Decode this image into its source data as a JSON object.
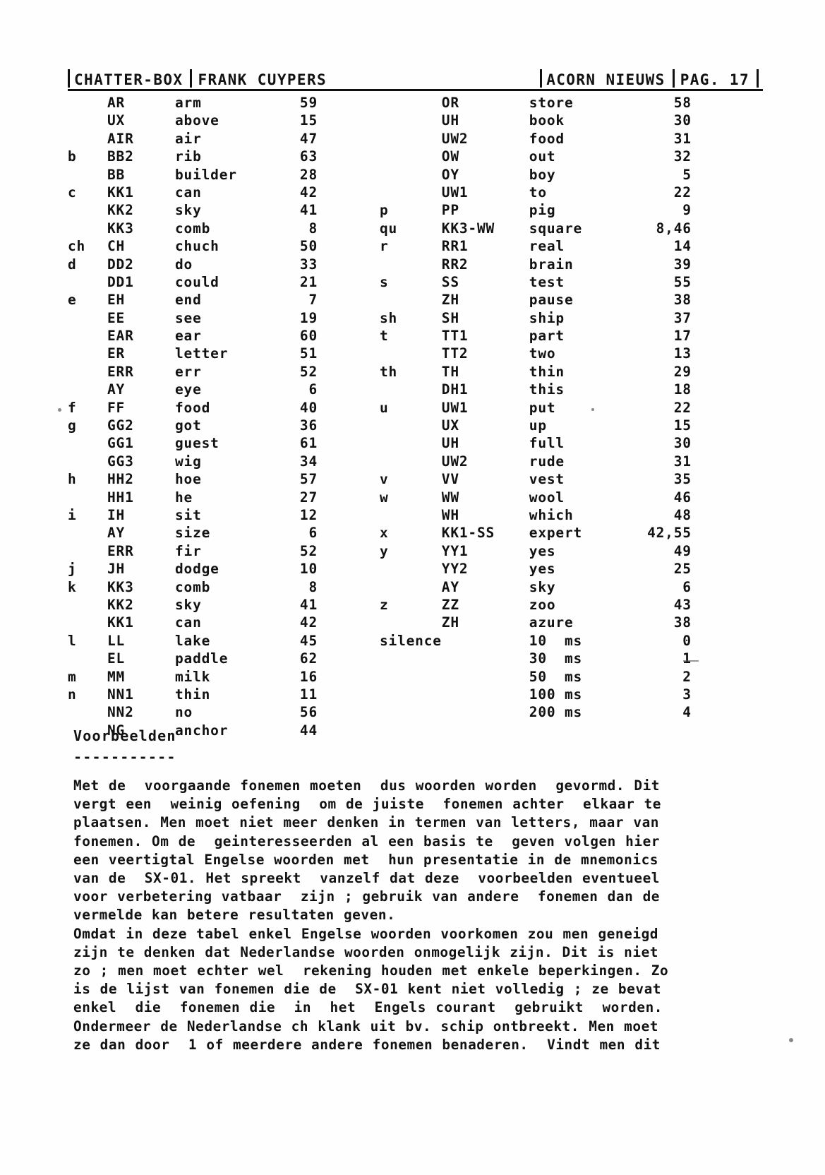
{
  "header": {
    "left_section": "CHATTER-BOX",
    "author": "FRANK CUYPERS",
    "publication": "ACORN NIEUWS",
    "page_label": "PAG.",
    "page_number": "17"
  },
  "table": {
    "rows_left": [
      {
        "letter": "",
        "phoneme": "AR",
        "word": "arm",
        "code": "59"
      },
      {
        "letter": "",
        "phoneme": "UX",
        "word": "above",
        "code": "15"
      },
      {
        "letter": "",
        "phoneme": "AIR",
        "word": "air",
        "code": "47"
      },
      {
        "letter": "b",
        "phoneme": "BB2",
        "word": "rib",
        "code": "63"
      },
      {
        "letter": "",
        "phoneme": "BB",
        "word": "builder",
        "code": "28"
      },
      {
        "letter": "c",
        "phoneme": "KK1",
        "word": "can",
        "code": "42"
      },
      {
        "letter": "",
        "phoneme": "KK2",
        "word": "sky",
        "code": "41"
      },
      {
        "letter": "",
        "phoneme": "KK3",
        "word": "comb",
        "code": "8"
      },
      {
        "letter": "ch",
        "phoneme": "CH",
        "word": "chuch",
        "code": "50"
      },
      {
        "letter": "d",
        "phoneme": "DD2",
        "word": "do",
        "code": "33"
      },
      {
        "letter": "",
        "phoneme": "DD1",
        "word": "could",
        "code": "21"
      },
      {
        "letter": "e",
        "phoneme": "EH",
        "word": "end",
        "code": "7"
      },
      {
        "letter": "",
        "phoneme": "EE",
        "word": "see",
        "code": "19"
      },
      {
        "letter": "",
        "phoneme": "EAR",
        "word": "ear",
        "code": "60"
      },
      {
        "letter": "",
        "phoneme": "ER",
        "word": "letter",
        "code": "51"
      },
      {
        "letter": "",
        "phoneme": "ERR",
        "word": "err",
        "code": "52"
      },
      {
        "letter": "",
        "phoneme": "AY",
        "word": "eye",
        "code": "6"
      },
      {
        "letter": "f",
        "phoneme": "FF",
        "word": "food",
        "code": "40"
      },
      {
        "letter": "g",
        "phoneme": "GG2",
        "word": "got",
        "code": "36"
      },
      {
        "letter": "",
        "phoneme": "GG1",
        "word": "guest",
        "code": "61"
      },
      {
        "letter": "",
        "phoneme": "GG3",
        "word": "wig",
        "code": "34"
      },
      {
        "letter": "h",
        "phoneme": "HH2",
        "word": "hoe",
        "code": "57"
      },
      {
        "letter": "",
        "phoneme": "HH1",
        "word": "he",
        "code": "27"
      },
      {
        "letter": "i",
        "phoneme": "IH",
        "word": "sit",
        "code": "12"
      },
      {
        "letter": "",
        "phoneme": "AY",
        "word": "size",
        "code": "6"
      },
      {
        "letter": "",
        "phoneme": "ERR",
        "word": "fir",
        "code": "52"
      },
      {
        "letter": "j",
        "phoneme": "JH",
        "word": "dodge",
        "code": "10"
      },
      {
        "letter": "k",
        "phoneme": "KK3",
        "word": "comb",
        "code": "8"
      },
      {
        "letter": "",
        "phoneme": "KK2",
        "word": "sky",
        "code": "41"
      },
      {
        "letter": "",
        "phoneme": "KK1",
        "word": "can",
        "code": "42"
      },
      {
        "letter": "l",
        "phoneme": "LL",
        "word": "lake",
        "code": "45"
      },
      {
        "letter": "",
        "phoneme": "EL",
        "word": "paddle",
        "code": "62"
      },
      {
        "letter": "m",
        "phoneme": "MM",
        "word": "milk",
        "code": "16"
      },
      {
        "letter": "n",
        "phoneme": "NN1",
        "word": "thin",
        "code": "11"
      },
      {
        "letter": "",
        "phoneme": "NN2",
        "word": "no",
        "code": "56"
      },
      {
        "letter": "",
        "phoneme": "NG",
        "word": "anchor",
        "code": "44"
      }
    ],
    "rows_right": [
      {
        "letter": "",
        "phoneme": "OR",
        "word": "store",
        "code": "58"
      },
      {
        "letter": "",
        "phoneme": "UH",
        "word": "book",
        "code": "30"
      },
      {
        "letter": "",
        "phoneme": "UW2",
        "word": "food",
        "code": "31"
      },
      {
        "letter": "",
        "phoneme": "OW",
        "word": "out",
        "code": "32"
      },
      {
        "letter": "",
        "phoneme": "OY",
        "word": "boy",
        "code": "5"
      },
      {
        "letter": "",
        "phoneme": "UW1",
        "word": "to",
        "code": "22"
      },
      {
        "letter": "p",
        "phoneme": "PP",
        "word": "pig",
        "code": "9"
      },
      {
        "letter": "qu",
        "phoneme": "KK3-WW",
        "word": "square",
        "code": "8,46"
      },
      {
        "letter": "r",
        "phoneme": "RR1",
        "word": "real",
        "code": "14"
      },
      {
        "letter": "",
        "phoneme": "RR2",
        "word": "brain",
        "code": "39"
      },
      {
        "letter": "s",
        "phoneme": "SS",
        "word": "test",
        "code": "55"
      },
      {
        "letter": "",
        "phoneme": "ZH",
        "word": "pause",
        "code": "38"
      },
      {
        "letter": "sh",
        "phoneme": "SH",
        "word": "ship",
        "code": "37"
      },
      {
        "letter": "t",
        "phoneme": "TT1",
        "word": "part",
        "code": "17"
      },
      {
        "letter": "",
        "phoneme": "TT2",
        "word": "two",
        "code": "13"
      },
      {
        "letter": "th",
        "phoneme": "TH",
        "word": "thin",
        "code": "29"
      },
      {
        "letter": "",
        "phoneme": "DH1",
        "word": "this",
        "code": "18"
      },
      {
        "letter": "u",
        "phoneme": "UW1",
        "word": "put",
        "code": "22"
      },
      {
        "letter": "",
        "phoneme": "UX",
        "word": "up",
        "code": "15"
      },
      {
        "letter": "",
        "phoneme": "UH",
        "word": "full",
        "code": "30"
      },
      {
        "letter": "",
        "phoneme": "UW2",
        "word": "rude",
        "code": "31"
      },
      {
        "letter": "v",
        "phoneme": "VV",
        "word": "vest",
        "code": "35"
      },
      {
        "letter": "w",
        "phoneme": "WW",
        "word": "wool",
        "code": "46"
      },
      {
        "letter": "",
        "phoneme": "WH",
        "word": "which",
        "code": "48"
      },
      {
        "letter": "x",
        "phoneme": "KK1-SS",
        "word": "expert",
        "code": "42,55"
      },
      {
        "letter": "y",
        "phoneme": "YY1",
        "word": "yes",
        "code": "49"
      },
      {
        "letter": "",
        "phoneme": "YY2",
        "word": "yes",
        "code": "25"
      },
      {
        "letter": "",
        "phoneme": "AY",
        "word": "sky",
        "code": "6"
      },
      {
        "letter": "z",
        "phoneme": "ZZ",
        "word": "zoo",
        "code": "43"
      },
      {
        "letter": "",
        "phoneme": "ZH",
        "word": "azure",
        "code": "38"
      },
      {
        "letter": "silence",
        "phoneme": "",
        "word": "10  ms",
        "code": "0"
      },
      {
        "letter": "",
        "phoneme": "",
        "word": "30  ms",
        "code": "1"
      },
      {
        "letter": "",
        "phoneme": "",
        "word": "50  ms",
        "code": "2"
      },
      {
        "letter": "",
        "phoneme": "",
        "word": "100 ms",
        "code": "3"
      },
      {
        "letter": "",
        "phoneme": "",
        "word": "200 ms",
        "code": "4"
      },
      {
        "letter": "",
        "phoneme": "",
        "word": "",
        "code": ""
      }
    ]
  },
  "section": {
    "title": "Voorbeelden",
    "underline": "-----------"
  },
  "body": {
    "paragraph": "Met de  voorgaande fonemen moeten  dus woorden worden  gevormd. Dit\nvergt een  weinig oefening  om de juiste  fonemen achter  elkaar te\nplaatsen. Men moet niet meer denken in termen van letters, maar van\nfonemen. Om de  geinteresseerden al een basis te  geven volgen hier\neen veertigtal Engelse woorden met  hun presentatie in de mnemonics\nvan de  SX-01. Het spreekt  vanzelf dat deze  voorbeelden eventueel\nvoor verbetering vatbaar  zijn ; gebruik van andere  fonemen dan de\nvermelde kan betere resultaten geven.\nOmdat in deze tabel enkel Engelse woorden voorkomen zou men geneigd\nzijn te denken dat Nederlandse woorden onmogelijk zijn. Dit is niet\nzo ; men moet echter wel  rekening houden met enkele beperkingen. Zo\nis de lijst van fonemen die de  SX-01 kent niet volledig ; ze bevat\nenkel  die  fonemen die  in  het  Engels courant  gebruikt  worden.\nOndermeer de Nederlandse ch klank uit bv. schip ontbreekt. Men moet\nze dan door  1 of meerdere andere fonemen benaderen.  Vindt men dit"
  }
}
